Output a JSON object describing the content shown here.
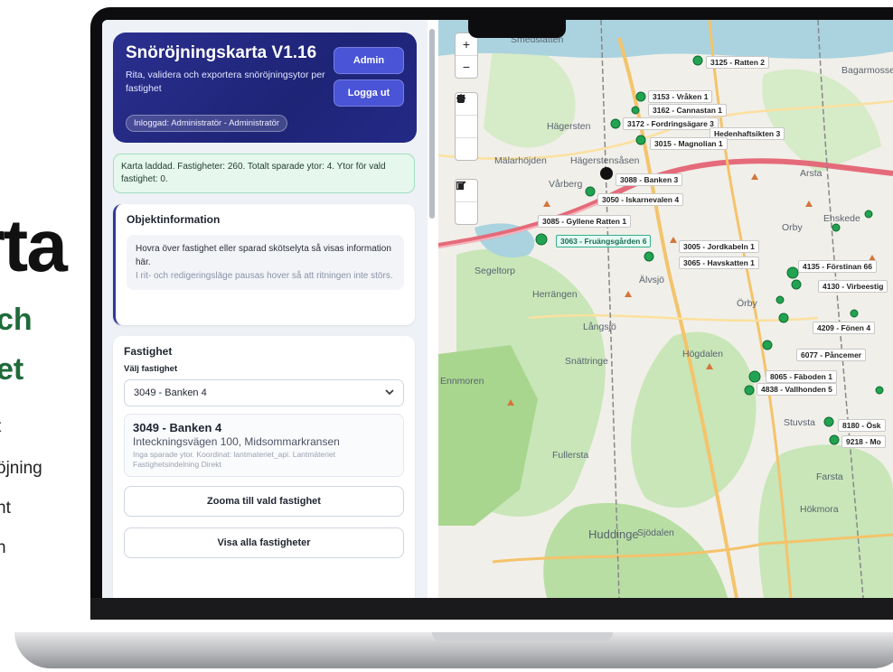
{
  "promo": {
    "big": "rta",
    "green_lines": [
      "ch",
      "et"
    ],
    "lines": [
      "t",
      "öjning",
      "nt",
      "h"
    ]
  },
  "app": {
    "title": "Snöröjningskarta V1.16",
    "subtitle": "Rita, validera och exportera snöröjningsytor per fastighet",
    "logged_in": "Inloggad: Administratör - Administratör",
    "admin_button": "Admin",
    "logout_button": "Logga ut"
  },
  "status": "Karta laddad. Fastigheter: 260. Totalt sparade ytor: 4. Ytor för vald fastighet: 0.",
  "object_info": {
    "heading": "Objektinformation",
    "hint": "Hovra över fastighet eller sparad skötselyta så visas information här.",
    "note": "I rit- och redigeringsläge pausas hover så att ritningen inte störs."
  },
  "property": {
    "heading": "Fastighet",
    "select_label": "Välj fastighet",
    "selected": "3049 - Banken 4",
    "card_name": "3049 - Banken 4",
    "card_address": "Inteckningsvägen 100, Midsommarkransen",
    "card_meta": "Inga sparade ytor. Koordinat: lantmateriet_api. Lantmäteriet Fastighetsindelning Direkt",
    "zoom_button": "Zooma till vald fastighet",
    "show_all_button": "Visa alla fastigheter"
  },
  "map": {
    "places": [
      "Smedslätten",
      "Hägersten",
      "Mälarhöjden",
      "Hägerstensåsen",
      "Vårberg",
      "Segeltorp",
      "Herrängen",
      "Älvsjö",
      "Örby",
      "Långsjö",
      "Snättringe",
      "Högdalen",
      "Fullersta",
      "Huddinge",
      "Sjödalen",
      "Farsta",
      "Hökmora",
      "Orby",
      "Stuvsta",
      "Arsta",
      "Enskede",
      "Bagarmossen",
      "Ennmoren"
    ],
    "labels": [
      {
        "text": "3125 - Ratten 2"
      },
      {
        "text": "3153 - Vråken 1"
      },
      {
        "text": "3162 - Cannastan 1"
      },
      {
        "text": "3172 - Fordringsägare 3"
      },
      {
        "text": "Hedenhaftsikten 3"
      },
      {
        "text": "3015 - Magnolian 1"
      },
      {
        "text": "3088 - Banken 3"
      },
      {
        "text": "3050 - Iskarnevalen 4"
      },
      {
        "text": "3085 - Gyllene Ratten 1"
      },
      {
        "text": "3063 - Fruängsgården 6",
        "selected": true
      },
      {
        "text": "3005 - Jordkabeln 1"
      },
      {
        "text": "3065 - Havskatten 1"
      },
      {
        "text": "4135 - Förstinan 66"
      },
      {
        "text": "4130 - Virbeestig"
      },
      {
        "text": "4209 - Fönen 4"
      },
      {
        "text": "6077 - Påncemer"
      },
      {
        "text": "8065 - Fäboden 1"
      },
      {
        "text": "4838 - Vallhonden 5"
      },
      {
        "text": "9218 - Mo"
      },
      {
        "text": "8180 - Ösk"
      }
    ]
  },
  "map_controls": {
    "zoom_in": "+",
    "zoom_out": "−"
  },
  "colors": {
    "header_bg": "#1e2476",
    "accent_button": "#4a54d6",
    "status_bg": "#e6f7ee",
    "marker": "#21a351"
  }
}
